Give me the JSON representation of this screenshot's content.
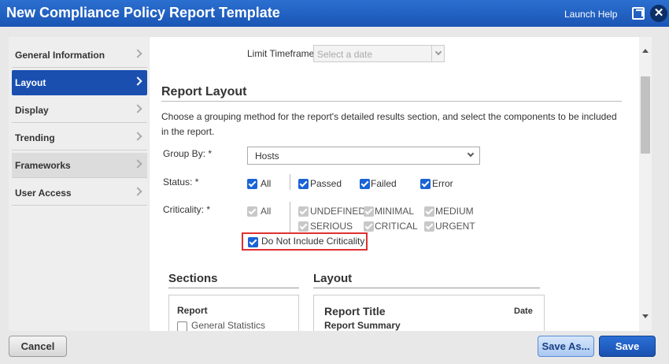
{
  "window": {
    "title": "New Compliance Policy Report Template",
    "help": "Launch Help",
    "close_glyph": "✕"
  },
  "sidebar": {
    "items": [
      {
        "label": "General Information"
      },
      {
        "label": "Layout"
      },
      {
        "label": "Display"
      },
      {
        "label": "Trending"
      },
      {
        "label": "Frameworks"
      },
      {
        "label": "User Access"
      }
    ]
  },
  "timeframe": {
    "label": "Limit Timeframe",
    "placeholder": "Select a date"
  },
  "report_layout": {
    "heading": "Report Layout",
    "description": "Choose a grouping method for the report's detailed results section, and select the components to be included in the report.",
    "group_by": {
      "label": "Group By: *",
      "value": "Hosts"
    },
    "status": {
      "label": "Status: *",
      "all": "All",
      "options": [
        "Passed",
        "Failed",
        "Error"
      ]
    },
    "criticality": {
      "label": "Criticality: *",
      "all": "All",
      "options": [
        "UNDEFINED",
        "MINIMAL",
        "MEDIUM",
        "SERIOUS",
        "CRITICAL",
        "URGENT"
      ],
      "exclude": "Do Not Include Criticality"
    }
  },
  "sections": {
    "heading": "Sections",
    "box_title": "Report",
    "item": "General Statistics"
  },
  "layout_preview": {
    "heading": "Layout",
    "title": "Report Title",
    "date": "Date",
    "sub": "Report Summary"
  },
  "icons": {
    "popout": "popout-icon",
    "close": "close-icon",
    "chevron": "chevron-right-icon",
    "caret": "caret-down-icon"
  },
  "buttons": {
    "cancel": "Cancel",
    "save_as": "Save As...",
    "save": "Save"
  },
  "colors": {
    "titlebar": "#1f5fc4",
    "active": "#1a4fb0",
    "highlight": "#e03030"
  }
}
